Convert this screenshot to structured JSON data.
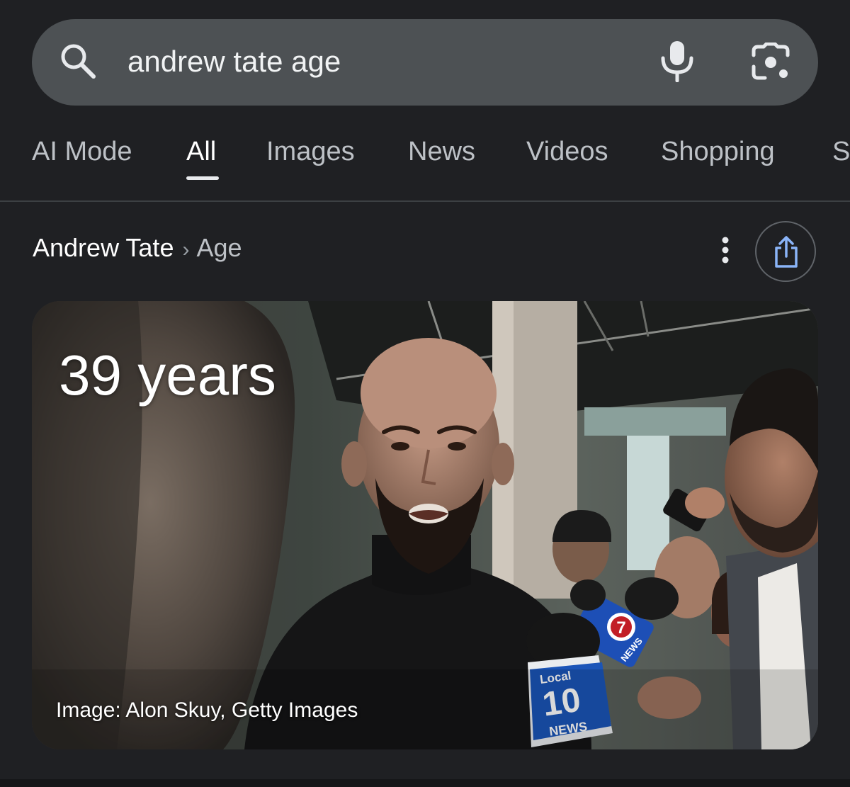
{
  "search": {
    "query": "andrew tate age",
    "icons": [
      "search-icon",
      "mic-icon",
      "lens-icon"
    ]
  },
  "tabs": [
    {
      "label": "AI Mode",
      "active": false
    },
    {
      "label": "All",
      "active": true
    },
    {
      "label": "Images",
      "active": false
    },
    {
      "label": "News",
      "active": false
    },
    {
      "label": "Videos",
      "active": false
    },
    {
      "label": "Shopping",
      "active": false
    },
    {
      "label": "S",
      "active": false
    }
  ],
  "breadcrumb": {
    "entity": "Andrew Tate",
    "separator": "›",
    "attribute": "Age"
  },
  "answer": {
    "value": "39 years",
    "image_caption": "Image: Alon Skuy, Getty Images"
  },
  "photo_text": {
    "mic_flag_top": "Local",
    "mic_flag_number": "10",
    "mic_flag_bottom": "NEWS",
    "mic2_number": "7",
    "mic2_label": "NEWS"
  },
  "colors": {
    "background": "#1f2023",
    "search_bar": "#4d5154",
    "active_tab": "#ffffff",
    "inactive_tab": "#bdc1c6"
  }
}
